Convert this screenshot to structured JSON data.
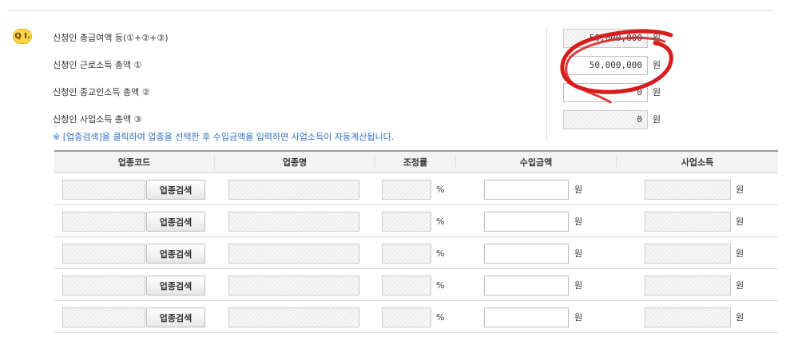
{
  "question": {
    "badge": "Q I.",
    "rows": [
      {
        "label": "신청인 총급여액 등(①+②+③)",
        "value": "50,000,000",
        "unit": "원"
      },
      {
        "label": "신청인 근로소득 총액 ①",
        "value": "50,000,000",
        "unit": "원"
      },
      {
        "label": "신청인 종교인소득 총액 ②",
        "value": "0",
        "unit": "원"
      },
      {
        "label": "신청인 사업소득 총액 ③",
        "value": "0",
        "unit": "원"
      }
    ],
    "note": "※ [업종검색]을 클릭하여 업종을 선택한 후 수입금액을 입력하면 사업소득이 자동계산됩니다."
  },
  "table": {
    "headers": [
      "업종코드",
      "업종명",
      "조정률",
      "수입금액",
      "사업소득"
    ],
    "search_button": "업종검색",
    "percent_unit": "%",
    "won_unit": "원",
    "rows": [
      {
        "code": "",
        "name": "",
        "rate": "",
        "revenue": "",
        "income": ""
      },
      {
        "code": "",
        "name": "",
        "rate": "",
        "revenue": "",
        "income": ""
      },
      {
        "code": "",
        "name": "",
        "rate": "",
        "revenue": "",
        "income": ""
      },
      {
        "code": "",
        "name": "",
        "rate": "",
        "revenue": "",
        "income": ""
      },
      {
        "code": "",
        "name": "",
        "rate": "",
        "revenue": "",
        "income": ""
      }
    ]
  },
  "colors": {
    "badge": "#ffd64a",
    "note": "#2f6fc0",
    "annotation": "#d81b1b"
  }
}
